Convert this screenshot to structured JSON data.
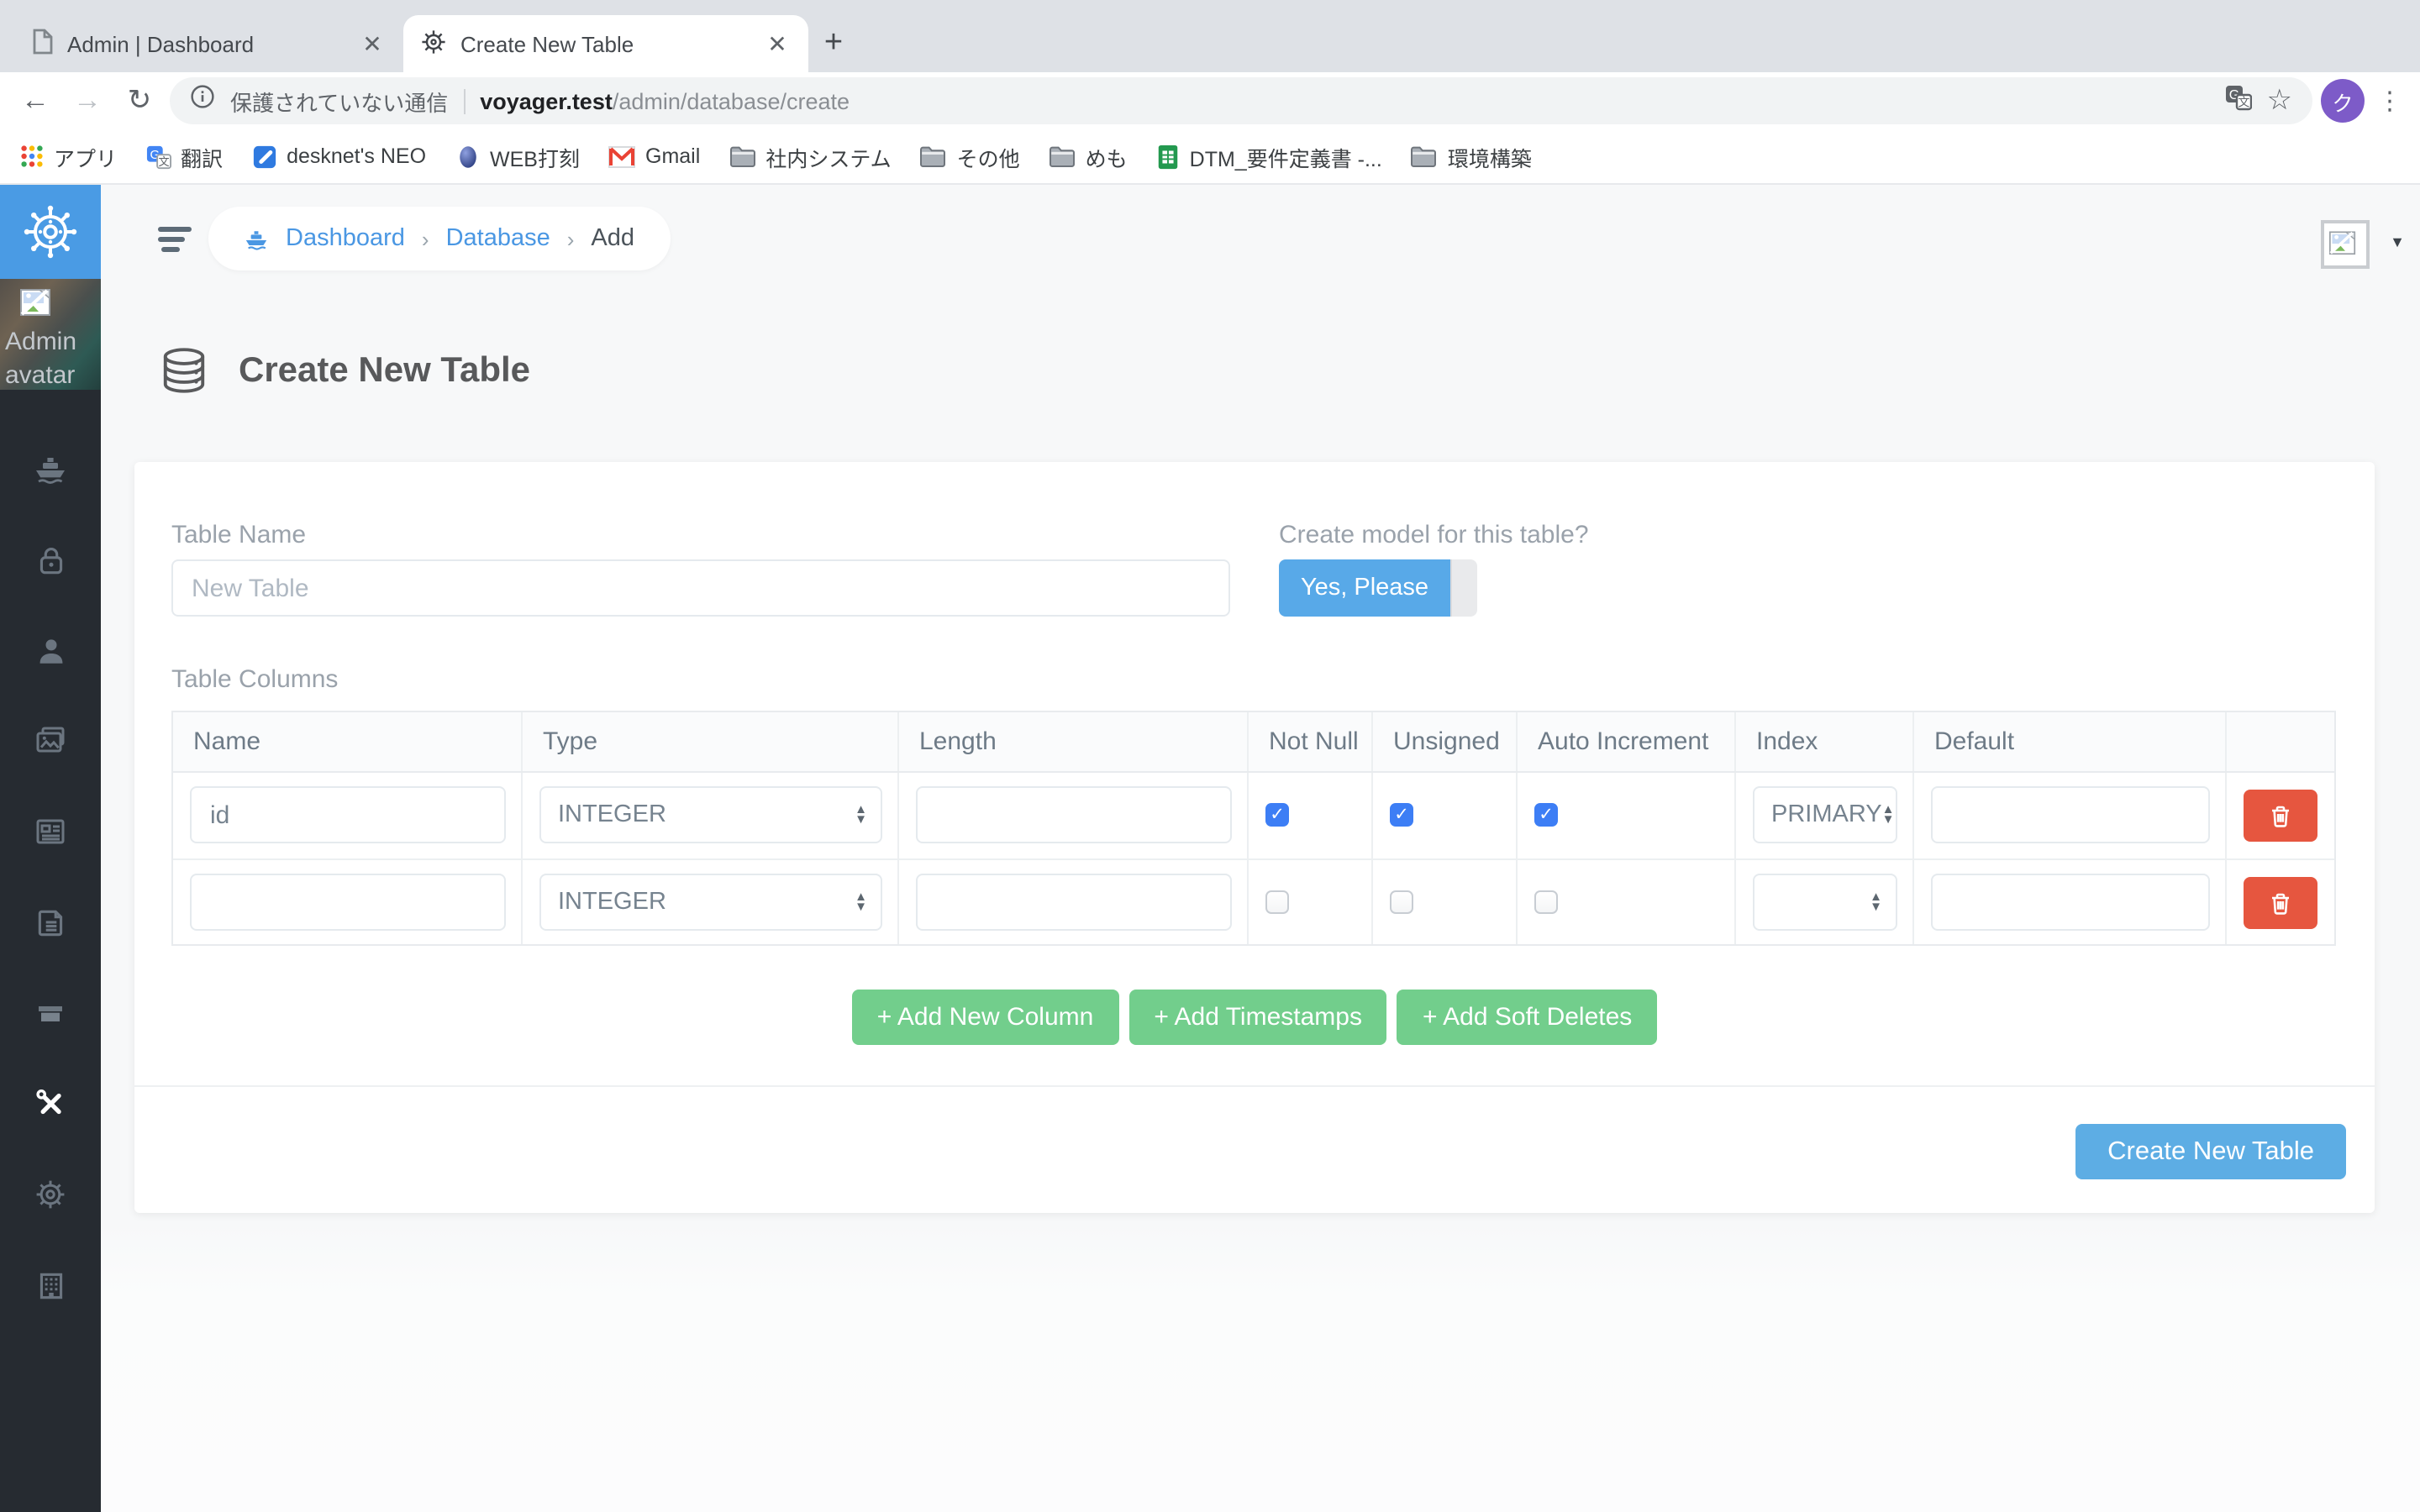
{
  "browser": {
    "tabs": [
      {
        "title": "Admin | Dashboard"
      },
      {
        "title": "Create New Table"
      }
    ],
    "new_tab": "+",
    "address": {
      "secure_label": "保護されていない通信",
      "host": "voyager.test",
      "path": "/admin/database/create"
    },
    "profile_initial": "ク",
    "bookmarks": [
      "アプリ",
      "翻訳",
      "desknet's NEO",
      "WEB打刻",
      "Gmail",
      "社内システム",
      "その他",
      "めも",
      "DTM_要件定義書 -...",
      "環境構築"
    ]
  },
  "sidebar": {
    "avatar_alt": "Admin avatar"
  },
  "header": {
    "breadcrumb": [
      "Dashboard",
      "Database",
      "Add"
    ]
  },
  "page": {
    "title": "Create New Table"
  },
  "form": {
    "table_name": {
      "label": "Table Name",
      "placeholder": "New Table"
    },
    "create_model": {
      "label": "Create model for this table?",
      "toggle_on": "Yes, Please"
    },
    "columns_label": "Table Columns",
    "table": {
      "headers": [
        "Name",
        "Type",
        "Length",
        "Not Null",
        "Unsigned",
        "Auto Increment",
        "Index",
        "Default"
      ],
      "rows": [
        {
          "name": "id",
          "type": "INTEGER",
          "length": "",
          "not_null": true,
          "unsigned": true,
          "auto_increment": true,
          "index": "PRIMARY",
          "default": ""
        },
        {
          "name": "",
          "type": "INTEGER",
          "length": "",
          "not_null": false,
          "unsigned": false,
          "auto_increment": false,
          "index": "",
          "default": ""
        }
      ]
    },
    "actions": {
      "add_column": "+ Add New Column",
      "add_timestamps": "+ Add Timestamps",
      "add_soft_deletes": "+ Add Soft Deletes"
    },
    "submit": "Create New Table"
  },
  "colors": {
    "logo_blue": "#4a9be4",
    "accent_blue": "#4a97e3",
    "button_blue": "#5dade4",
    "success_green": "#72ce8c",
    "danger_red": "#e6563f",
    "checkbox_blue": "#3d7ef5",
    "sidebar_dark": "#262b31"
  }
}
